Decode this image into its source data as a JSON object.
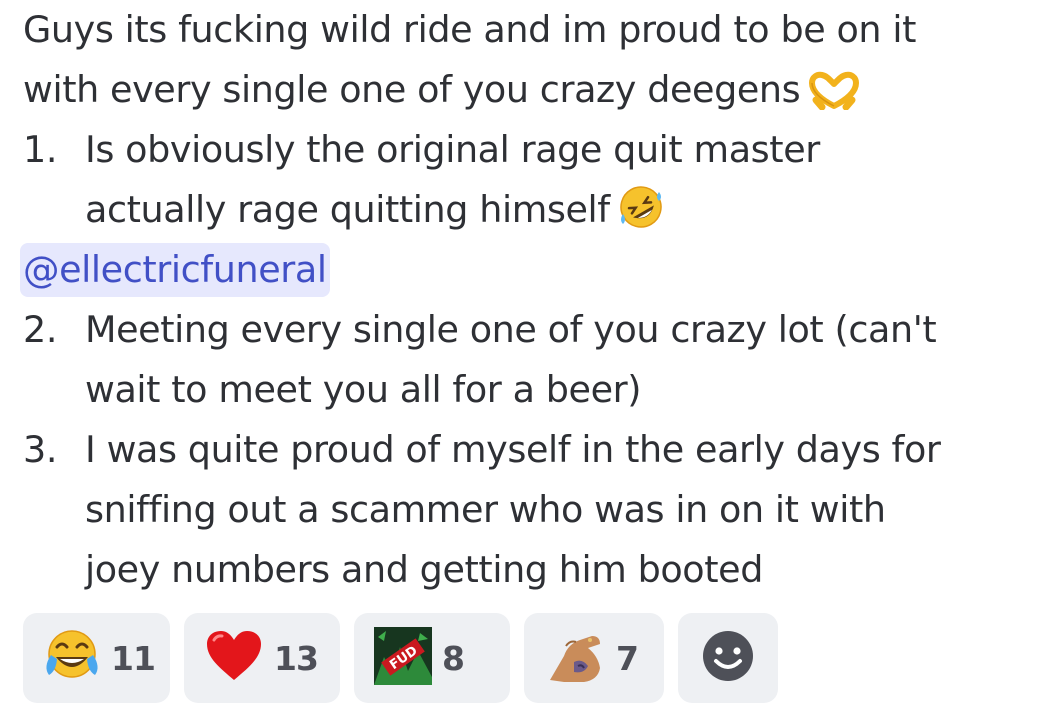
{
  "message": {
    "intro_line1": "Guys its fucking wild ride and im proud to be on it",
    "intro_line2": "with every single one of you crazy deegens",
    "intro_emoji": "heart-hands-emoji",
    "items": [
      {
        "number": "1.",
        "lines": [
          "Is obviously the original rage quit master",
          "actually rage quitting himself"
        ],
        "emoji": "rolling-on-floor-laughing-emoji"
      },
      {
        "number": "2.",
        "lines": [
          "Meeting every single one of you crazy lot (can't",
          "wait to meet you all for a beer)"
        ]
      },
      {
        "number": "3.",
        "lines": [
          "I was quite proud of myself in the early days for",
          "sniffing out a scammer who was in on it with",
          "joey numbers and getting him booted"
        ]
      }
    ],
    "mention": "@ellectricfuneral"
  },
  "reactions": [
    {
      "icon": "joy-tears-emoji",
      "count": "11"
    },
    {
      "icon": "red-heart-emoji",
      "count": "13"
    },
    {
      "icon": "custom-fud-emoji",
      "count": "8"
    },
    {
      "icon": "custom-flexed-arm-emoji",
      "count": "7"
    }
  ],
  "add_reaction_icon": "add-reaction-smiley-icon",
  "colors": {
    "text": "#2e3035",
    "mention_bg": "#e6e8fd",
    "mention_text": "#4150c6",
    "reaction_bg": "#eef0f3",
    "reaction_count": "#4e5058"
  }
}
